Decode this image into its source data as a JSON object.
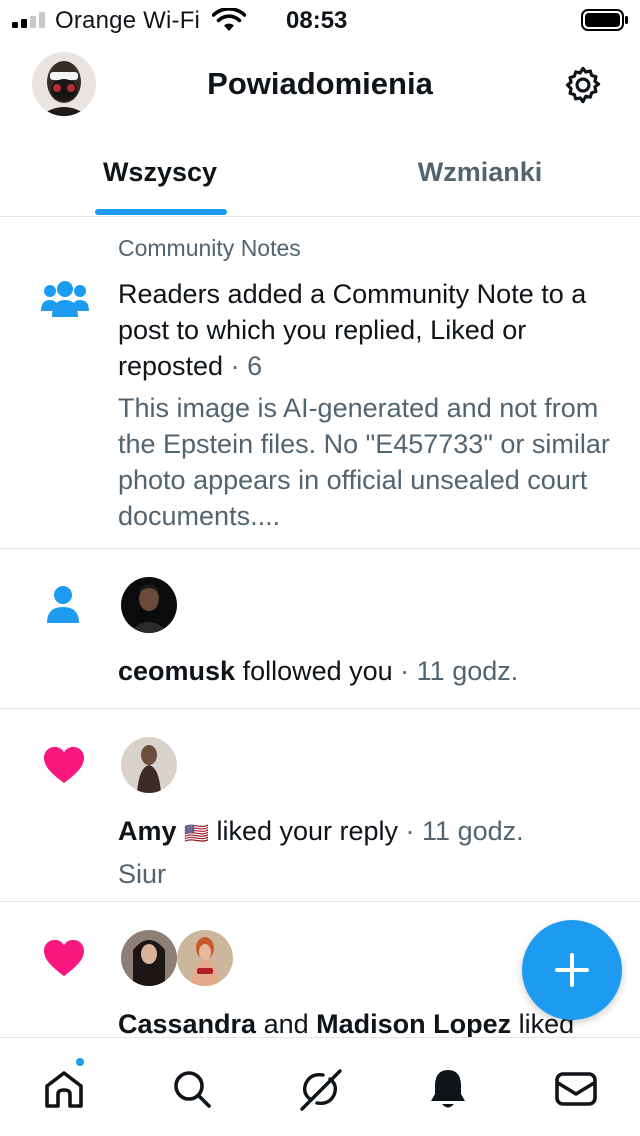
{
  "status_bar": {
    "carrier": "Orange Wi-Fi",
    "time": "08:53"
  },
  "header": {
    "title": "Powiadomienia"
  },
  "tabs": [
    {
      "label": "Wszyscy",
      "active": true
    },
    {
      "label": "Wzmianki",
      "active": false
    }
  ],
  "notifications": [
    {
      "type": "community-note",
      "category": "Community Notes",
      "text": "Readers added a Community Note to a post to which you replied, Liked or reposted",
      "count": " · 6",
      "snippet": "This image is AI-generated and not from the Epstein files. No \"E457733\" or similar photo appears in official unsealed court documents...."
    },
    {
      "type": "follow",
      "user": "ceomusk",
      "action": " followed you",
      "time": " · 11 godz."
    },
    {
      "type": "like",
      "user": "Amy",
      "flag": "🇺🇸",
      "action": " liked your reply",
      "time": " · 11 godz.",
      "reply_text": "Siur"
    },
    {
      "type": "like",
      "user1": "Cassandra",
      "connector": " and ",
      "user2": "Madison Lopez",
      "action": " liked"
    }
  ],
  "colors": {
    "accent": "#1d9bf0",
    "like": "#f91880",
    "muted": "#536471",
    "text": "#0f1419",
    "divider": "#e1e6ea"
  },
  "icons": {
    "community": "people-icon",
    "follow": "person-icon",
    "like": "heart-icon",
    "settings": "gear-icon",
    "fab": "plus-icon",
    "nav": [
      "home-icon",
      "search-icon",
      "grok-icon",
      "bell-icon",
      "mail-icon"
    ]
  }
}
